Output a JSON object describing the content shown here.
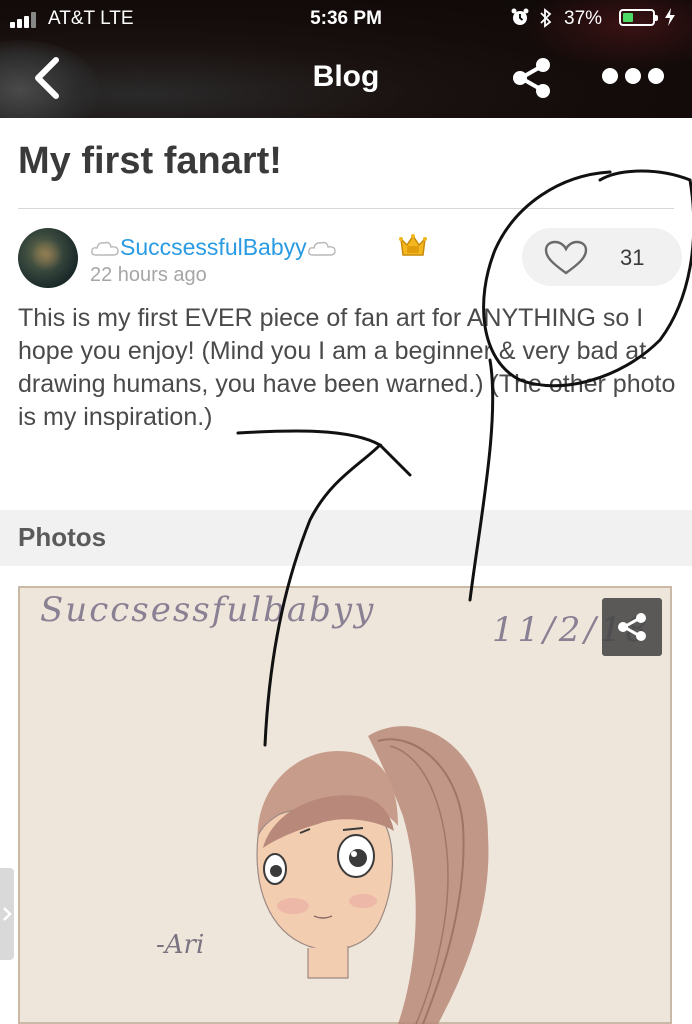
{
  "status_bar": {
    "carrier": "AT&T  LTE",
    "time": "5:36 PM",
    "battery_percent": "37%",
    "battery_level": 0.37,
    "battery_color": "#4cd964",
    "icons": [
      "signal-bars-icon",
      "alarm-icon",
      "bluetooth-icon",
      "battery-icon",
      "charging-bolt-icon"
    ]
  },
  "nav": {
    "title": "Blog",
    "back_icon": "chevron-left-icon",
    "share_icon": "share-icon",
    "more_icon": "more-dots-icon"
  },
  "post": {
    "title": "My first fanart!",
    "author": {
      "name": "SuccsessfulBabyy",
      "time_ago": "22 hours ago",
      "badge_icon": "crown-level-badge-icon",
      "decoration_icon": "cloud-icon"
    },
    "likes": {
      "count": "31",
      "icon": "heart-icon"
    },
    "body": "This is my first EVER piece of fan art for ANYTHING so I hope you enjoy! (Mind you I am a beginner & very bad at drawing humans, you have been warned.) (The other photo is my inspiration.)"
  },
  "photos_section": {
    "label": "Photos",
    "photo": {
      "signature": "Succsessfulbabyy",
      "date": "11/2/18",
      "artist_mark": "-Ari",
      "share_icon": "share-icon"
    }
  },
  "colors": {
    "link_blue": "#2a9be2",
    "title_text": "#3a3a3a",
    "muted_text": "#a6a6a6",
    "section_bg": "#f1f1f1"
  }
}
